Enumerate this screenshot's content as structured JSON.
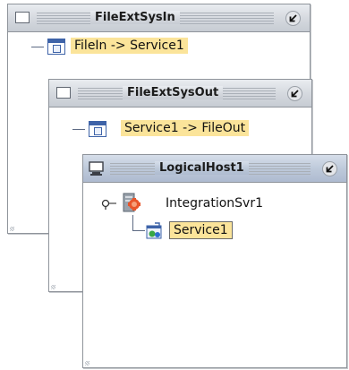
{
  "windows": [
    {
      "title": "FileExtSysIn",
      "item_label": "FileIn -> Service1"
    },
    {
      "title": "FileExtSysOut",
      "item_label": "Service1 -> FileOut"
    },
    {
      "title": "LogicalHost1",
      "server_label": "IntegrationSvr1",
      "service_label": "Service1"
    }
  ],
  "icons": {
    "system_box": "window-menu-icon",
    "restore": "restore-arrow-icon",
    "component": "component-window-icon",
    "host": "monitor-icon",
    "server": "server-icon",
    "service": "service-icon",
    "tree_pin": "tree-node-pin-icon"
  },
  "colors": {
    "label_highlight": "#fbe49a",
    "titlebar": "#d4d8de",
    "active_titlebar": "#bcc8d9",
    "border": "#8f949b"
  }
}
